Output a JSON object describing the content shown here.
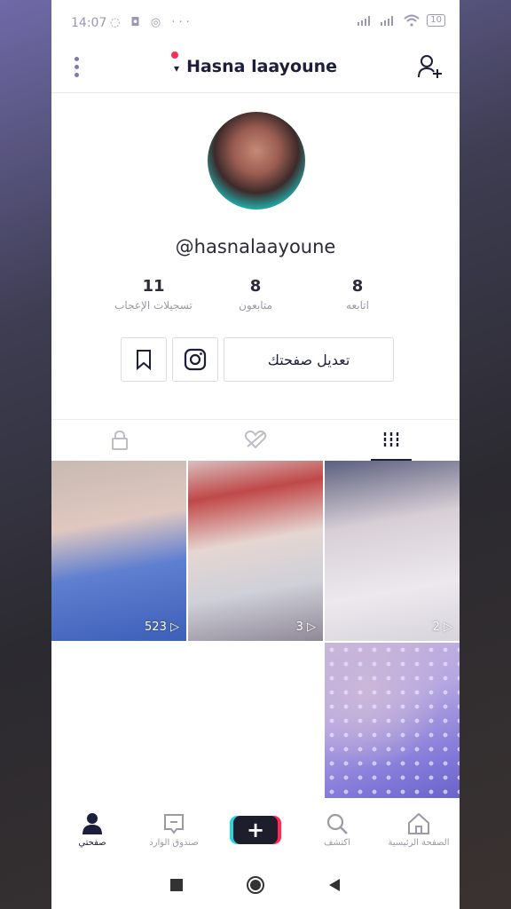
{
  "status_bar": {
    "time": "14:07",
    "left_icons": "◌ ◘ ◎ ···",
    "battery": "10"
  },
  "header": {
    "title": "Hasna laayoune",
    "caret": "▾"
  },
  "profile": {
    "handle": "@hasnalaayoune",
    "stats": [
      {
        "value": "11",
        "label": "تسجيلات الإعجاب"
      },
      {
        "value": "8",
        "label": "متابعون"
      },
      {
        "value": "8",
        "label": "اتابعه"
      }
    ],
    "edit_button": "تعديل صفحتك"
  },
  "videos": [
    {
      "views": "523"
    },
    {
      "views": "3"
    },
    {
      "views": "2"
    }
  ],
  "bottom_nav": [
    {
      "label": "صفحتي",
      "icon": "profile-icon",
      "active": true
    },
    {
      "label": "صندوق الوارد",
      "icon": "inbox-icon"
    },
    {
      "label": "",
      "icon": "create-icon"
    },
    {
      "label": "اكتشف",
      "icon": "discover-icon"
    },
    {
      "label": "الصفحة الرئيسية",
      "icon": "home-icon"
    }
  ],
  "colors": {
    "accent_red": "#fe2c55",
    "accent_cyan": "#2ad4e0",
    "text_dark": "#1d1d3c"
  }
}
